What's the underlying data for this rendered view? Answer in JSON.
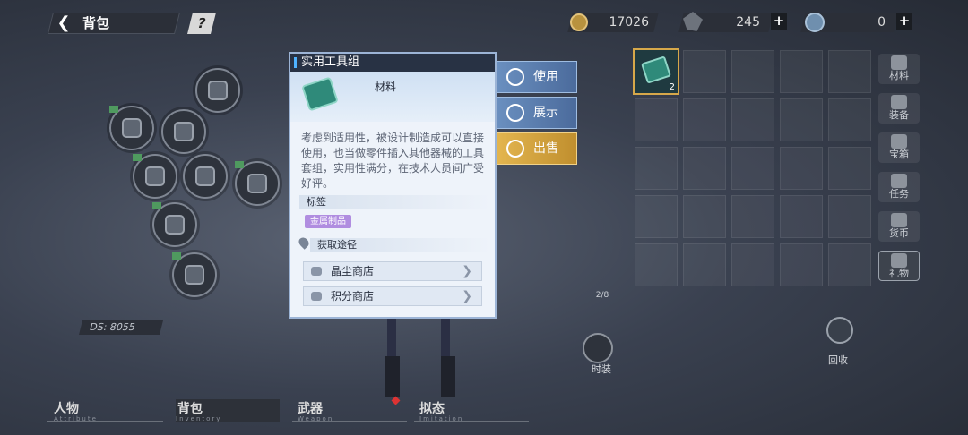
{
  "header": {
    "title": "背包",
    "help": "?"
  },
  "currencies": [
    {
      "name": "coin-icon",
      "value": "17026"
    },
    {
      "name": "stamina-icon",
      "value": "245",
      "plus": "+"
    },
    {
      "name": "crystal-icon",
      "value": "0",
      "plus": "+"
    }
  ],
  "popup": {
    "title": "实用工具组",
    "type": "材料",
    "description": "考虑到适用性，被设计制造成可以直接使用，也当做零件插入其他器械的工具套组，实用性满分，在技术人员间广受好评。",
    "tags_header": "标签",
    "tags": [
      "金属制品"
    ],
    "sources_header": "获取途径",
    "sources": [
      "晶尘商店",
      "积分商店"
    ]
  },
  "actions": {
    "use": "使用",
    "show": "展示",
    "sell": "出售"
  },
  "inventory": {
    "selected_qty": "2"
  },
  "sidebar": [
    "材料",
    "装备",
    "宝箱",
    "任务",
    "货币",
    "礼物"
  ],
  "bottom_tabs": [
    {
      "label": "人物",
      "sub": "Attribute"
    },
    {
      "label": "背包",
      "sub": "Inventory"
    },
    {
      "label": "武器",
      "sub": "Weapon"
    },
    {
      "label": "拟态",
      "sub": "Imitation"
    }
  ],
  "misc": {
    "ds": "DS: 8055",
    "recycle": "回收",
    "fashion": "时装",
    "counter": "2/8"
  },
  "colors": {
    "accent_blue": "#4fb2ff",
    "sell_gold": "#d6a84a",
    "tag_purple": "#b08de0"
  }
}
